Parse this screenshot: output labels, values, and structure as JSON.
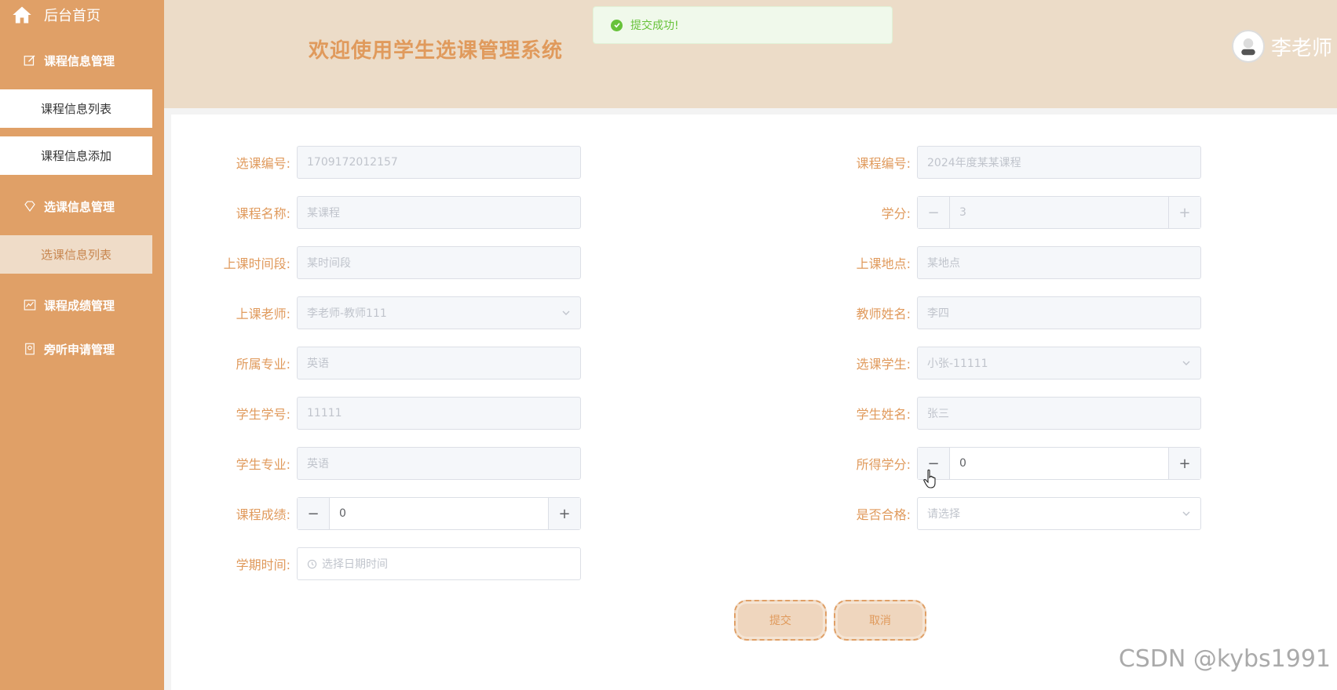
{
  "sidebar": {
    "home_label": "后台首页",
    "menus": [
      {
        "label": "课程信息管理",
        "icon": "edit-icon"
      },
      {
        "label": "选课信息管理",
        "icon": "diamond-icon"
      },
      {
        "label": "课程成绩管理",
        "icon": "chart-icon"
      },
      {
        "label": "旁听申请管理",
        "icon": "badge-icon"
      }
    ],
    "sub_items": [
      {
        "label": "课程信息列表"
      },
      {
        "label": "课程信息添加"
      },
      {
        "label": "选课信息列表",
        "active": true
      }
    ]
  },
  "header": {
    "title": "欢迎使用学生选课管理系统",
    "user_name": "李老师"
  },
  "toast": {
    "message": "提交成功!"
  },
  "form": {
    "left": [
      {
        "label": "选课编号:",
        "value": "1709172012157"
      },
      {
        "label": "课程名称:",
        "value": "某课程"
      },
      {
        "label": "上课时间段:",
        "value": "某时间段"
      },
      {
        "label": "上课老师:",
        "value": "李老师-教师111"
      },
      {
        "label": "所属专业:",
        "value": "英语"
      },
      {
        "label": "学生学号:",
        "value": "11111"
      },
      {
        "label": "学生专业:",
        "value": "英语"
      },
      {
        "label": "课程成绩:",
        "value": "0"
      },
      {
        "label": "学期时间:",
        "placeholder": "选择日期时间"
      }
    ],
    "right": [
      {
        "label": "课程编号:",
        "value": "2024年度某某课程"
      },
      {
        "label": "学分:",
        "value": "3"
      },
      {
        "label": "上课地点:",
        "value": "某地点"
      },
      {
        "label": "教师姓名:",
        "value": "李四"
      },
      {
        "label": "选课学生:",
        "value": "小张-11111"
      },
      {
        "label": "学生姓名:",
        "value": "张三"
      },
      {
        "label": "所得学分:",
        "value": "0"
      },
      {
        "label": "是否合格:",
        "placeholder": "请选择"
      }
    ],
    "stepper_minus": "−",
    "stepper_plus": "+"
  },
  "actions": {
    "submit": "提交",
    "cancel": "取消"
  },
  "watermark": "CSDN @kybs1991",
  "colors": {
    "sidebar": "#e0a067",
    "header": "#ecdcc8",
    "accent": "#e09a5c",
    "success": "#67c23a"
  }
}
